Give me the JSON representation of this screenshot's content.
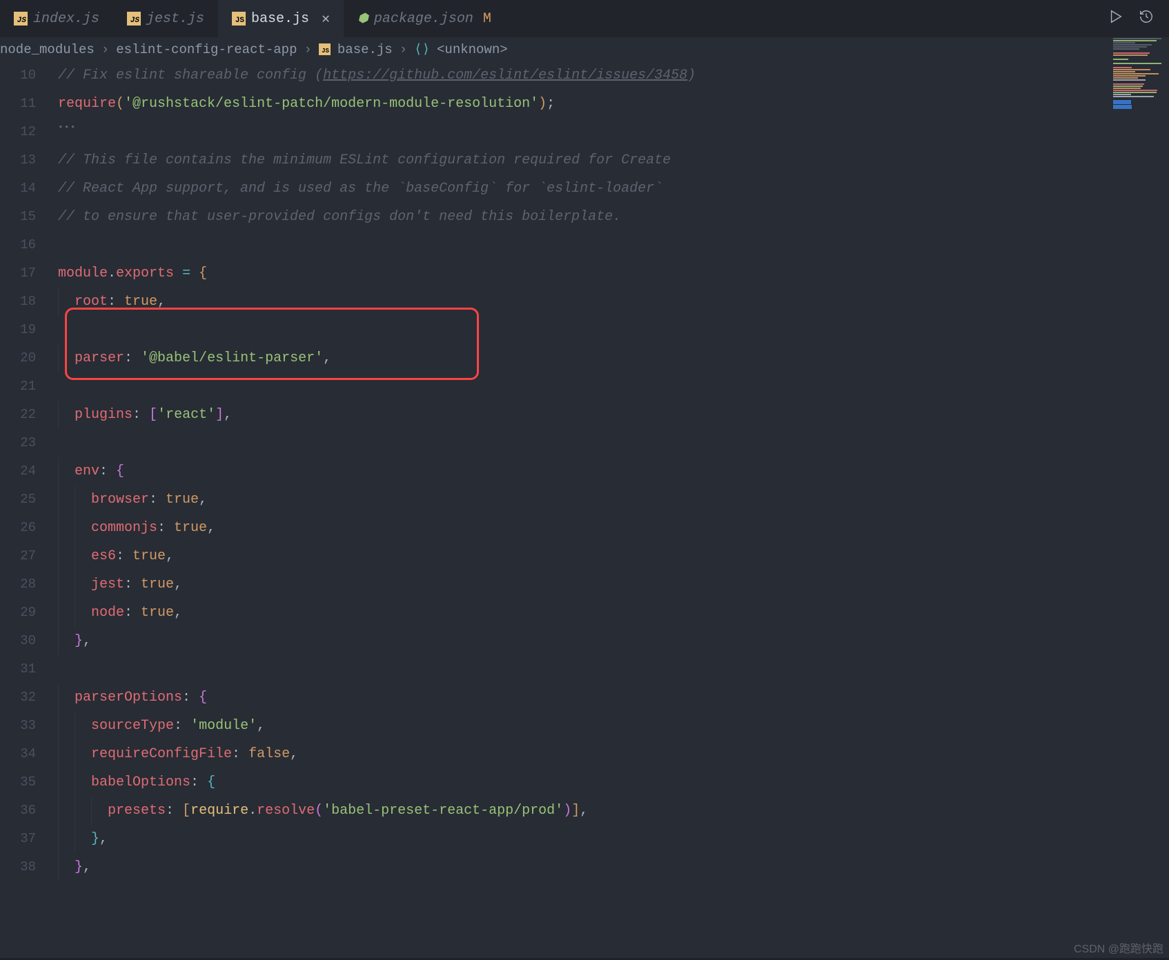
{
  "tabs": [
    {
      "icon": "js",
      "label": "index.js",
      "active": false
    },
    {
      "icon": "js",
      "label": "jest.js",
      "active": false
    },
    {
      "icon": "js",
      "label": "base.js",
      "active": true,
      "close": true
    },
    {
      "icon": "json",
      "label": "package.json",
      "git": "M",
      "active": false
    }
  ],
  "actions": {
    "run": "▷",
    "history": "↻"
  },
  "breadcrumb": {
    "seg1": "node_modules",
    "seg2": "eslint-config-react-app",
    "seg3": "base.js",
    "seg4": "<unknown>"
  },
  "line_start": 10,
  "lines": [
    {
      "n": 10,
      "t": "cmt",
      "pre": "  ",
      "text": "// Fix eslint shareable config (",
      "url": "https://github.com/eslint/eslint/issues/3458",
      "suf": ")"
    },
    {
      "n": 11,
      "t": "req",
      "pre": "  "
    },
    {
      "n": 12,
      "t": "blank"
    },
    {
      "n": 13,
      "t": "cmt2",
      "pre": "  ",
      "text": "// This file contains the minimum ESLint configuration required for Create"
    },
    {
      "n": 14,
      "t": "cmt2",
      "pre": "  ",
      "text": "// React App support, and is used as the `baseConfig` for `eslint-loader`"
    },
    {
      "n": 15,
      "t": "cmt2",
      "pre": "  ",
      "text": "// to ensure that user-provided configs don't need this boilerplate."
    },
    {
      "n": 16,
      "t": "blank"
    },
    {
      "n": 17,
      "t": "export"
    },
    {
      "n": 18,
      "t": "prop",
      "ind": 1,
      "k": "root",
      "v": "true",
      "vt": "bool"
    },
    {
      "n": 19,
      "t": "blank"
    },
    {
      "n": 20,
      "t": "prop",
      "ind": 1,
      "k": "parser",
      "v": "'@babel/eslint-parser'",
      "vt": "str"
    },
    {
      "n": 21,
      "t": "blank"
    },
    {
      "n": 22,
      "t": "plugins",
      "ind": 1,
      "k": "plugins",
      "v": "'react'"
    },
    {
      "n": 23,
      "t": "blank"
    },
    {
      "n": 24,
      "t": "open",
      "ind": 1,
      "k": "env",
      "br": "{",
      "bc": "brP"
    },
    {
      "n": 25,
      "t": "prop",
      "ind": 2,
      "k": "browser",
      "v": "true",
      "vt": "bool"
    },
    {
      "n": 26,
      "t": "prop",
      "ind": 2,
      "k": "commonjs",
      "v": "true",
      "vt": "bool"
    },
    {
      "n": 27,
      "t": "prop",
      "ind": 2,
      "k": "es6",
      "v": "true",
      "vt": "bool"
    },
    {
      "n": 28,
      "t": "prop",
      "ind": 2,
      "k": "jest",
      "v": "true",
      "vt": "bool"
    },
    {
      "n": 29,
      "t": "prop",
      "ind": 2,
      "k": "node",
      "v": "true",
      "vt": "bool"
    },
    {
      "n": 30,
      "t": "close",
      "ind": 1,
      "br": "}",
      "bc": "brP"
    },
    {
      "n": 31,
      "t": "blank"
    },
    {
      "n": 32,
      "t": "open",
      "ind": 1,
      "k": "parserOptions",
      "br": "{",
      "bc": "brP"
    },
    {
      "n": 33,
      "t": "prop",
      "ind": 2,
      "k": "sourceType",
      "v": "'module'",
      "vt": "str"
    },
    {
      "n": 34,
      "t": "prop",
      "ind": 2,
      "k": "requireConfigFile",
      "v": "false",
      "vt": "bool"
    },
    {
      "n": 35,
      "t": "open",
      "ind": 2,
      "k": "babelOptions",
      "br": "{",
      "bc": "brB"
    },
    {
      "n": 36,
      "t": "presets",
      "ind": 3
    },
    {
      "n": 37,
      "t": "close",
      "ind": 2,
      "br": "}",
      "bc": "brB"
    },
    {
      "n": 38,
      "t": "close",
      "ind": 1,
      "br": "}",
      "bc": "brP"
    }
  ],
  "req_str": "'@rushstack/eslint-patch/modern-module-resolution'",
  "presets_str": "'babel-preset-react-app/prod'",
  "watermark": "CSDN @跑跑快跑"
}
